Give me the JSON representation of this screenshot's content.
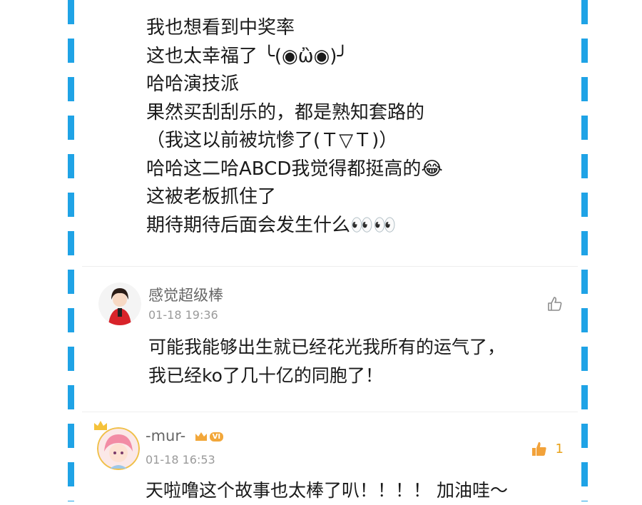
{
  "post_lines": [
    "我也想看到中奖率",
    "这也太幸福了 ╰(◉ὢ◉)╯",
    "哈哈演技派",
    "果然买刮刮乐的，都是熟知套路的",
    "（我这以前被坑惨了(Ｔ▽Ｔ)）",
    "哈哈这二哈ABCD我觉得都挺高的😂",
    "这被老板抓住了",
    "期待期待后面会发生什么👀👀"
  ],
  "comments": [
    {
      "nickname": "感觉超级棒",
      "time": "01-18 19:36",
      "like_count": "",
      "body": [
        "可能我能够出生就已经花光我所有的运气了，",
        "我已经ko了几十亿的同胞了！"
      ]
    },
    {
      "nickname": "-mur-",
      "vip": "VI",
      "time": "01-18 16:53",
      "like_count": "1",
      "body": [
        "天啦噜这个故事也太棒了叭！！！！ 加油哇～"
      ]
    }
  ],
  "colors": {
    "border_dash": "#1fa3e6",
    "like_active": "#f2a23a"
  }
}
